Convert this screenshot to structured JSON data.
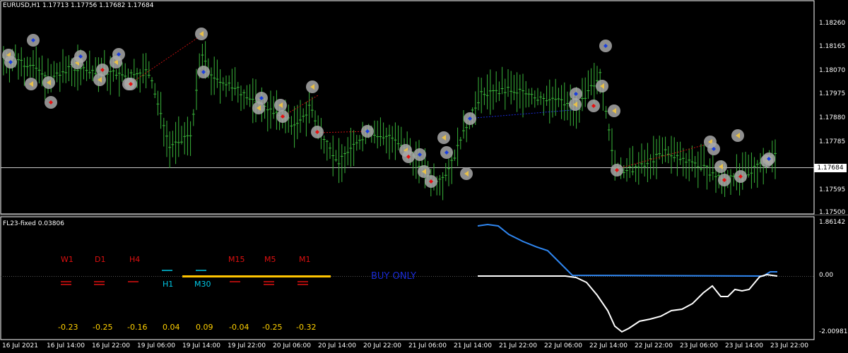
{
  "header": {
    "symbol_title": "EURUSD,H1  1.17713 1.17756 1.17682 1.17684",
    "current_price_tag": "1.17684"
  },
  "indicator": {
    "title": "FL23-fixed 0.03806",
    "buy_status": "BUY ONLY",
    "timeframes": [
      {
        "label": "W1",
        "color": "#e01010",
        "value": "-0.23"
      },
      {
        "label": "D1",
        "color": "#e01010",
        "value": "-0.25"
      },
      {
        "label": "H4",
        "color": "#e01010",
        "value": "-0.16"
      },
      {
        "label": "H1",
        "color": "#00c8e6",
        "value": "0.04"
      },
      {
        "label": "M30",
        "color": "#00c8e6",
        "value": "0.09"
      },
      {
        "label": "M15",
        "color": "#e01010",
        "value": "-0.04"
      },
      {
        "label": "M5",
        "color": "#e01010",
        "value": "-0.25"
      },
      {
        "label": "M1",
        "color": "#e01010",
        "value": "-0.32"
      }
    ],
    "y_ticks": [
      "1.86142",
      "0.00",
      "-2.00981"
    ]
  },
  "price_axis": {
    "ticks": [
      "1.18260",
      "1.18165",
      "1.18070",
      "1.17975",
      "1.17880",
      "1.17785",
      "1.17595",
      "1.17500"
    ]
  },
  "time_axis": {
    "ticks": [
      "16 Jul 2021",
      "16 Jul 14:00",
      "16 Jul 22:00",
      "19 Jul 06:00",
      "19 Jul 14:00",
      "19 Jul 22:00",
      "20 Jul 06:00",
      "20 Jul 14:00",
      "20 Jul 22:00",
      "21 Jul 06:00",
      "21 Jul 14:00",
      "21 Jul 22:00",
      "22 Jul 06:00",
      "22 Jul 14:00",
      "22 Jul 22:00",
      "23 Jul 06:00",
      "23 Jul 14:00",
      "23 Jul 22:00"
    ]
  },
  "colors": {
    "background": "#000000",
    "candle": "#39b53a",
    "grid_border": "#ffffff",
    "indicator_blue": "#2f86f0",
    "indicator_white": "#ffffff",
    "bar_yellow": "#ffc400",
    "red_text": "#e01010",
    "cyan_text": "#00c8e6"
  }
}
